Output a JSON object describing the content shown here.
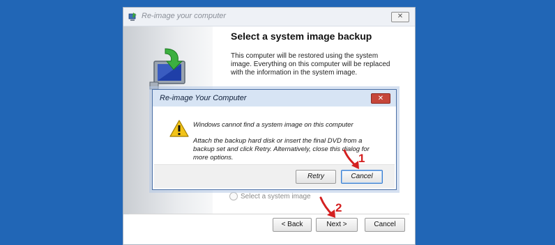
{
  "wizard": {
    "title": "Re-image your computer",
    "close_symbol": "✕",
    "heading": "Select a system image backup",
    "description": "This computer will be restored using the system image. Everything on this computer will be replaced with the information in the system image.",
    "option_label": "Select a system image",
    "buttons": {
      "back": "< Back",
      "next": "Next >",
      "cancel": "Cancel"
    }
  },
  "dialog": {
    "title": "Re-image Your Computer",
    "close_symbol": "✕",
    "message": "Windows cannot find a system image on this computer",
    "detail": "Attach the backup hard disk or insert the final DVD from a backup set and click Retry. Alternatively, close this dialog for more options.",
    "buttons": {
      "retry": "Retry",
      "cancel": "Cancel"
    },
    "icon": "warning-icon"
  },
  "annotations": {
    "step1": "1",
    "step2": "2"
  },
  "colors": {
    "desktop": "#2166b6",
    "annotation": "#d42020",
    "dialog_close": "#c6463a"
  }
}
